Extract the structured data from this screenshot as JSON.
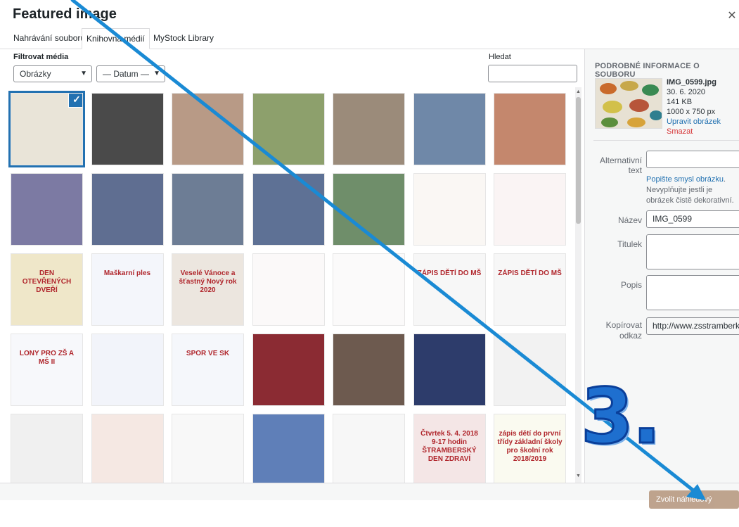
{
  "modal": {
    "title": "Featured image",
    "close_icon": "close-icon"
  },
  "tabs": [
    {
      "label": "Nahrávání souborů"
    },
    {
      "label": "Knihovna médií"
    },
    {
      "label": "MyStock Library"
    }
  ],
  "filters": {
    "label": "Filtrovat média",
    "type_select": "Obrázky",
    "date_select": "— Datum —"
  },
  "search": {
    "label": "Hledat",
    "value": ""
  },
  "grid": {
    "items": [
      {
        "caption": "",
        "bg": "#e9e4d8",
        "selected": true
      },
      {
        "caption": "",
        "bg": "#4a4a4a"
      },
      {
        "caption": "",
        "bg": "#b89a86"
      },
      {
        "caption": "",
        "bg": "#8da06c"
      },
      {
        "caption": "",
        "bg": "#9b8b7a"
      },
      {
        "caption": "",
        "bg": "#6f88a8"
      },
      {
        "caption": "",
        "bg": "#c4876d"
      },
      {
        "caption": "",
        "bg": "#7c7aa3"
      },
      {
        "caption": "",
        "bg": "#5f6e91"
      },
      {
        "caption": "",
        "bg": "#6d7d95"
      },
      {
        "caption": "",
        "bg": "#5e7195"
      },
      {
        "caption": "",
        "bg": "#6f8e6a"
      },
      {
        "caption": "",
        "bg": "#faf7f4"
      },
      {
        "caption": "",
        "bg": "#faf4f4"
      },
      {
        "caption": "DEN OTEVŘENÝCH DVEŘÍ",
        "bg": "#efe7c9"
      },
      {
        "caption": "Maškarní ples",
        "bg": "#f4f6fb"
      },
      {
        "caption": "Veselé Vánoce a šťastný Nový rok 2020",
        "bg": "#ece6df"
      },
      {
        "caption": "",
        "bg": "#fbf9f9"
      },
      {
        "caption": "",
        "bg": "#fbfafa"
      },
      {
        "caption": "ZÁPIS DĚTÍ DO MŠ",
        "bg": "#f7f7f7"
      },
      {
        "caption": "ZÁPIS DĚTÍ DO MŠ",
        "bg": "#f7f7f7"
      },
      {
        "caption": "LONY PRO ZŠ A MŠ II",
        "bg": "#f7f8fb"
      },
      {
        "caption": "",
        "bg": "#f2f4fa"
      },
      {
        "caption": "SPOR VE SK",
        "bg": "#f5f7fb"
      },
      {
        "caption": "",
        "bg": "#8b2b33"
      },
      {
        "caption": "",
        "bg": "#6d5a4f"
      },
      {
        "caption": "",
        "bg": "#2d3c6b"
      },
      {
        "caption": "",
        "bg": "#f2f2f2"
      },
      {
        "caption": "",
        "bg": "#f0f0f0"
      },
      {
        "caption": "",
        "bg": "#f5e8e3"
      },
      {
        "caption": "",
        "bg": "#f8f8f8"
      },
      {
        "caption": "",
        "bg": "#5f7fb8"
      },
      {
        "caption": "",
        "bg": "#f7f7f7"
      },
      {
        "caption": "Čtvrtek 5. 4. 2018 9-17 hodin ŠTRAMBERSKÝ DEN ZDRAVÍ",
        "bg": "#f4e6e6"
      },
      {
        "caption": "zápis dětí do první třídy základní školy pro školní rok 2018/2019",
        "bg": "#fafaf0"
      }
    ]
  },
  "sidebar": {
    "heading": "PODROBNÉ INFORMACE O SOUBORU",
    "filename": "IMG_0599.jpg",
    "date": "30. 6. 2020",
    "size": "141 KB",
    "dimensions": "1000 x 750 px",
    "edit_link": "Upravit obrázek",
    "delete_link": "Smazat",
    "alt_label": "Alternativní text",
    "alt_value": "",
    "alt_help_link": "Popište smysl obrázku",
    "alt_help_text": "Nevyplňujte jestli je obrázek čistě dekorativní.",
    "name_label": "Název",
    "name_value": "IMG_0599",
    "caption_label": "Titulek",
    "caption_value": "",
    "desc_label": "Popis",
    "desc_value": "",
    "copy_label": "Kopírovat odkaz",
    "copy_value": "http://www.zsstramberk.cz/"
  },
  "footer": {
    "set_button": "Zvolit náhledový obrázek"
  },
  "annotation": {
    "number": "3.",
    "color": "#1e6fcf"
  }
}
